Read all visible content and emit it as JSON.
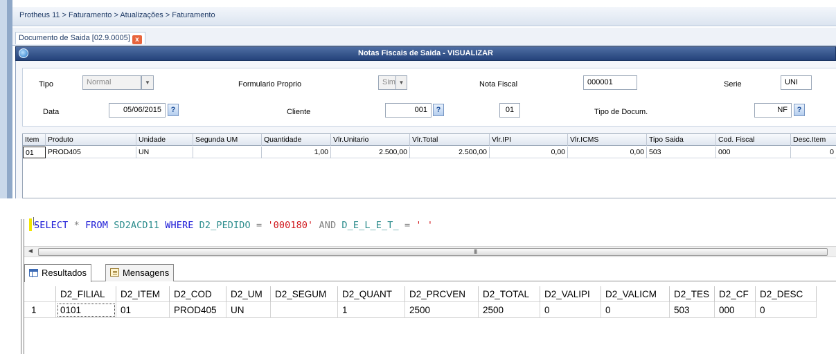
{
  "protheus": {
    "breadcrumb": "Protheus 11 > Faturamento > Atualizações > Faturamento",
    "tab_label": "Documento de Saida [02.9.0005]",
    "tab_close": "x",
    "window_title": "Notas Fiscais de Saida - VISUALIZAR",
    "fields": {
      "tipo_label": "Tipo",
      "tipo_value": "Normal",
      "formulario_label": "Formulario Proprio",
      "formulario_value": "Sim",
      "nota_label": "Nota Fiscal",
      "nota_value": "000001",
      "serie_label": "Serie",
      "serie_value": "UNI",
      "data_label": "Data",
      "data_value": "05/06/2015",
      "cliente_label": "Cliente",
      "cliente_value": "001",
      "loja_value": "01",
      "tipodoc_label": "Tipo de Docum.",
      "tipodoc_value": "NF",
      "help_glyph": "?"
    },
    "grid_headers": [
      "Item",
      "Produto",
      "Unidade",
      "Segunda UM",
      "Quantidade",
      "Vlr.Unitario",
      "Vlr.Total",
      "Vlr.IPI",
      "Vlr.ICMS",
      "Tipo Saida",
      "Cod. Fiscal",
      "Desc.Item"
    ],
    "grid_row": [
      "01",
      "PROD405",
      "UN",
      "",
      "1,00",
      "2.500,00",
      "2.500,00",
      "0,00",
      "0,00",
      "503",
      "000",
      "0"
    ]
  },
  "ssms": {
    "query": {
      "select": "SELECT",
      "star": "*",
      "from": "FROM",
      "table": "SD2ACD11",
      "where": "WHERE",
      "col1": "D2_PEDIDO",
      "eq1": "=",
      "val1": "'000180'",
      "and": "AND",
      "col2": "D_E_L_E_T_",
      "eq2": "=",
      "val2": "' '"
    },
    "scroll_left_arrow": "◄",
    "scroll_grip": "III",
    "tabs": {
      "results": "Resultados",
      "messages": "Mensagens"
    },
    "headers": [
      "D2_FILIAL",
      "D2_ITEM",
      "D2_COD",
      "D2_UM",
      "D2_SEGUM",
      "D2_QUANT",
      "D2_PRCVEN",
      "D2_TOTAL",
      "D2_VALIPI",
      "D2_VALICM",
      "D2_TES",
      "D2_CF",
      "D2_DESC"
    ],
    "row_number": "1",
    "row": [
      "0101",
      "01",
      "PROD405",
      "UN",
      "",
      "1",
      "2500",
      "2500",
      "0",
      "0",
      "503",
      "000",
      "0"
    ]
  }
}
